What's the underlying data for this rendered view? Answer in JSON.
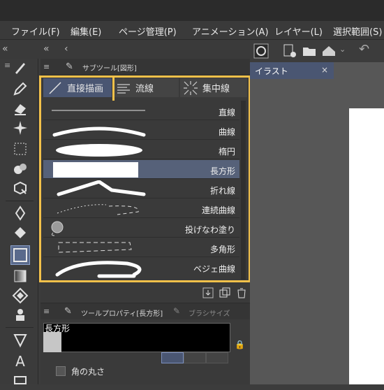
{
  "menu": [
    "ファイル(F)",
    "編集(E)",
    "ページ管理(P)",
    "アニメーション(A)",
    "レイヤー(L)",
    "選択範囲(S)"
  ],
  "subtool_panel": {
    "title": "サブツール[図形]",
    "tabs": [
      {
        "label": "直接描画",
        "active": true
      },
      {
        "label": "流線",
        "active": false
      },
      {
        "label": "集中線",
        "active": false
      }
    ],
    "items": [
      {
        "label": "直線",
        "selected": false
      },
      {
        "label": "曲線",
        "selected": false
      },
      {
        "label": "楕円",
        "selected": false
      },
      {
        "label": "長方形",
        "selected": true
      },
      {
        "label": "折れ線",
        "selected": false
      },
      {
        "label": "連続曲線",
        "selected": false
      },
      {
        "label": "投げなわ塗り",
        "selected": false
      },
      {
        "label": "多角形",
        "selected": false
      },
      {
        "label": "ベジェ曲線",
        "selected": false
      }
    ]
  },
  "tool_property": {
    "title": "ツールプロパティ[長方形]",
    "brush_tab": "ブラシサイズ",
    "preview_label": "長方形",
    "option": "角の丸さ"
  },
  "document": {
    "tab_label": "イラスト",
    "close": "×"
  },
  "colors": {
    "highlight": "#f2c14a",
    "selected_row": "#566179",
    "active_tab": "#4a5672"
  }
}
